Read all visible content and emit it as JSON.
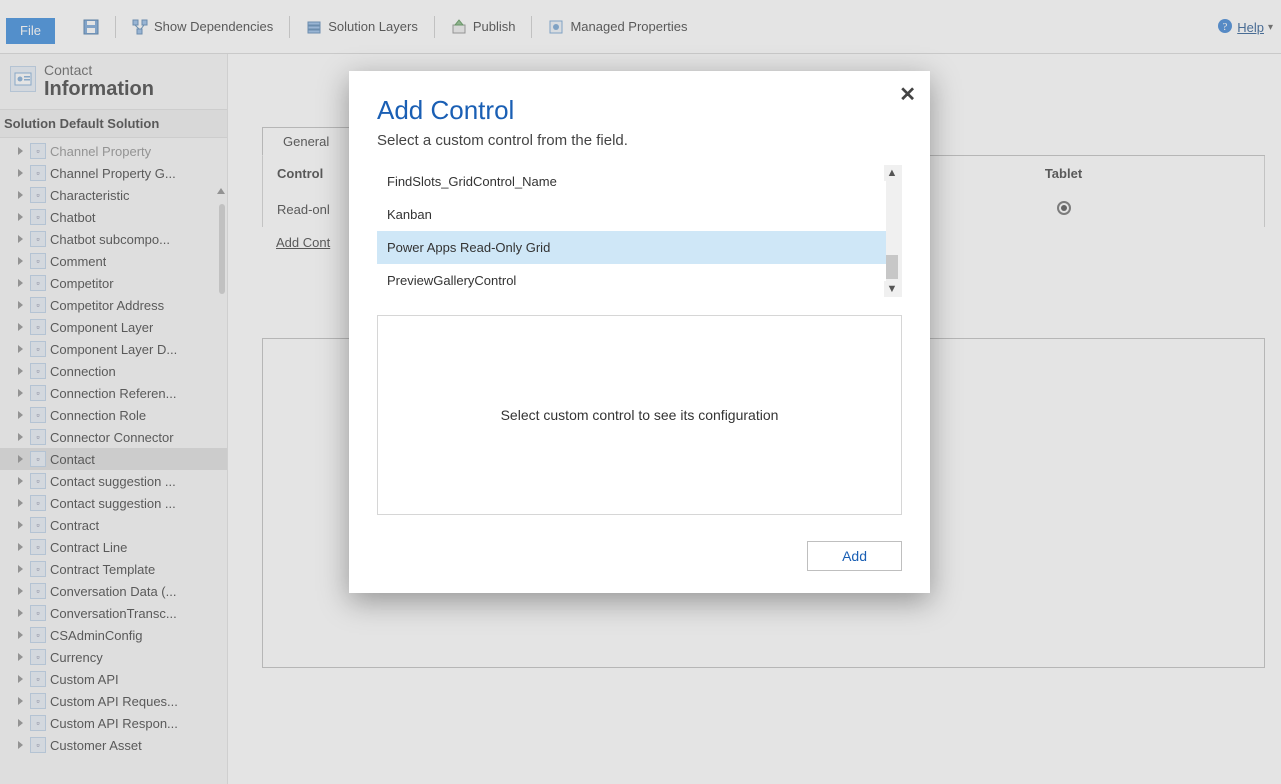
{
  "toolbar": {
    "file": "File",
    "save_icon": "save-icon",
    "show_dependencies": "Show Dependencies",
    "solution_layers": "Solution Layers",
    "publish": "Publish",
    "managed_properties": "Managed Properties",
    "help": "Help"
  },
  "entity": {
    "name": "Contact",
    "form": "Information"
  },
  "solution": {
    "title": "Solution Default Solution"
  },
  "tree": [
    {
      "label": "Channel Property",
      "dim": true
    },
    {
      "label": "Channel Property G..."
    },
    {
      "label": "Characteristic"
    },
    {
      "label": "Chatbot"
    },
    {
      "label": "Chatbot subcompo..."
    },
    {
      "label": "Comment"
    },
    {
      "label": "Competitor"
    },
    {
      "label": "Competitor Address"
    },
    {
      "label": "Component Layer"
    },
    {
      "label": "Component Layer D..."
    },
    {
      "label": "Connection"
    },
    {
      "label": "Connection Referen..."
    },
    {
      "label": "Connection Role"
    },
    {
      "label": "Connector Connector"
    },
    {
      "label": "Contact",
      "selected": true
    },
    {
      "label": "Contact suggestion ..."
    },
    {
      "label": "Contact suggestion ..."
    },
    {
      "label": "Contract"
    },
    {
      "label": "Contract Line"
    },
    {
      "label": "Contract Template"
    },
    {
      "label": "Conversation Data (..."
    },
    {
      "label": "ConversationTransc..."
    },
    {
      "label": "CSAdminConfig"
    },
    {
      "label": "Currency"
    },
    {
      "label": "Custom API"
    },
    {
      "label": "Custom API Reques..."
    },
    {
      "label": "Custom API Respon..."
    },
    {
      "label": "Customer Asset"
    }
  ],
  "tabs": {
    "general": "General"
  },
  "grid": {
    "control_header": "Control",
    "tablet_header": "Tablet",
    "row_readonly": "Read-onl",
    "add_control": "Add Cont"
  },
  "modal": {
    "title": "Add Control",
    "subtitle": "Select a custom control from the field.",
    "items": [
      "FindSlots_GridControl_Name",
      "Kanban",
      "Power Apps Read-Only Grid",
      "PreviewGalleryControl"
    ],
    "selected_index": 2,
    "config_placeholder": "Select custom control to see its configuration",
    "add_button": "Add"
  }
}
